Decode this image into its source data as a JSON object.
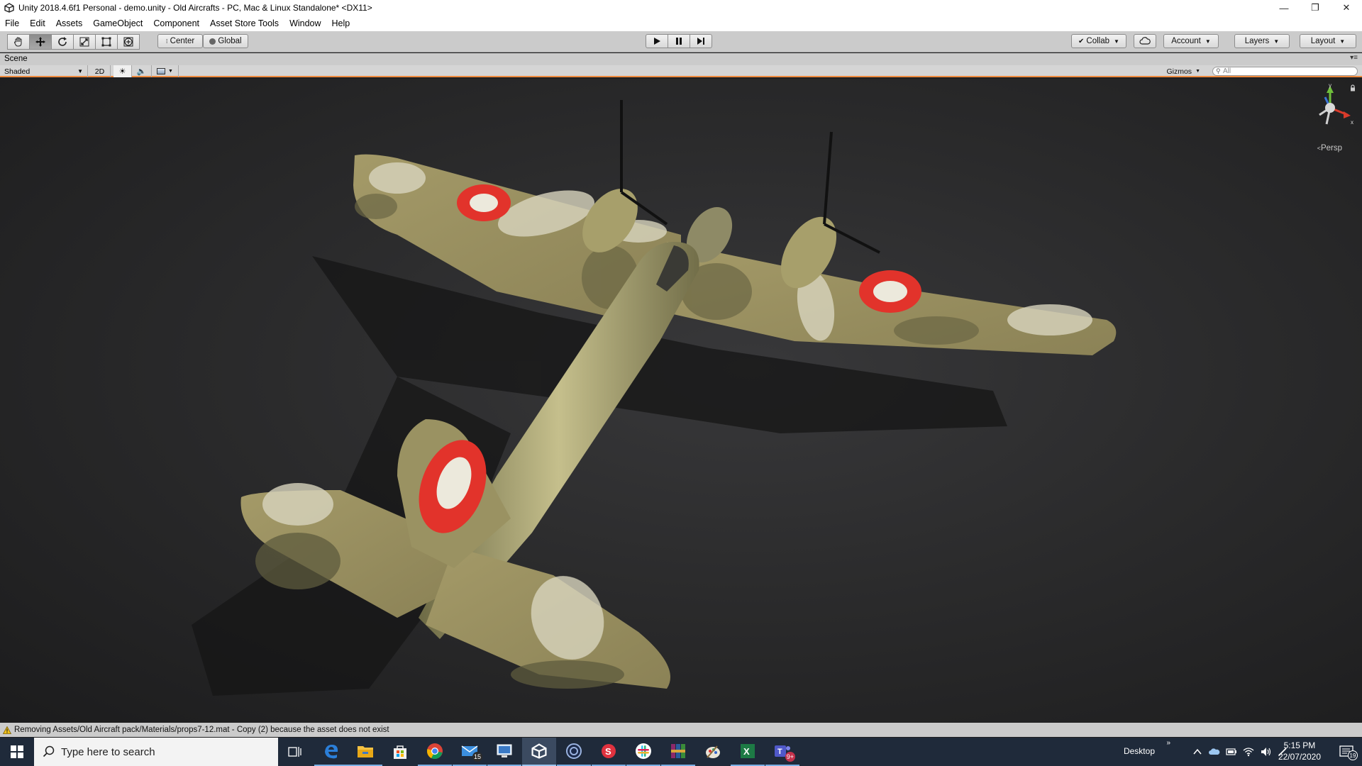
{
  "window": {
    "title": "Unity 2018.4.6f1 Personal - demo.unity - Old Aircrafts - PC, Mac & Linux Standalone* <DX11>",
    "controls": {
      "minimize": "—",
      "maximize": "❐",
      "close": "✕"
    }
  },
  "menubar": [
    "File",
    "Edit",
    "Assets",
    "GameObject",
    "Component",
    "Asset Store Tools",
    "Window",
    "Help"
  ],
  "toolbar": {
    "transform_tools": [
      "hand-icon",
      "move-icon",
      "rotate-icon",
      "scale-icon",
      "rect-icon",
      "transform-icon"
    ],
    "active_tool": "move-icon",
    "pivot": "Center",
    "space": "Global",
    "collab": "Collab",
    "account": "Account",
    "layers": "Layers",
    "layout": "Layout"
  },
  "scene": {
    "tab_label": "Scene",
    "shading_mode": "Shaded",
    "mode_2d": "2D",
    "gizmos": "Gizmos",
    "search_placeholder": "All",
    "projection": "Persp",
    "axis_y": "y",
    "axis_x": "x"
  },
  "status": {
    "message": "Removing Assets/Old Aircraft pack/Materials/props7-12.mat - Copy (2) because the asset does not exist"
  },
  "taskbar": {
    "search_placeholder": "Type here to search",
    "apps": [
      {
        "name": "task-view-icon"
      },
      {
        "name": "edge-icon"
      },
      {
        "name": "file-explorer-icon"
      },
      {
        "name": "store-icon"
      },
      {
        "name": "chrome-icon"
      },
      {
        "name": "mail-icon",
        "badge": "15"
      },
      {
        "name": "remote-desktop-icon"
      },
      {
        "name": "unity-icon"
      },
      {
        "name": "cinema4d-icon"
      },
      {
        "name": "substance-icon"
      },
      {
        "name": "slack-icon"
      },
      {
        "name": "winrar-icon"
      },
      {
        "name": "paint-icon"
      },
      {
        "name": "excel-icon"
      },
      {
        "name": "teams-icon",
        "badge": "9+"
      }
    ],
    "desktop_label": "Desktop",
    "time": "5:15 PM",
    "date": "22/07/2020",
    "notifications": "19"
  },
  "colors": {
    "editor_gray": "#cbcbcb",
    "scene_accent": "#ee8a3d",
    "taskbar_bg": "#1f2a3a",
    "camo_base": "#9c9362",
    "roundel_red": "#e2332b"
  }
}
